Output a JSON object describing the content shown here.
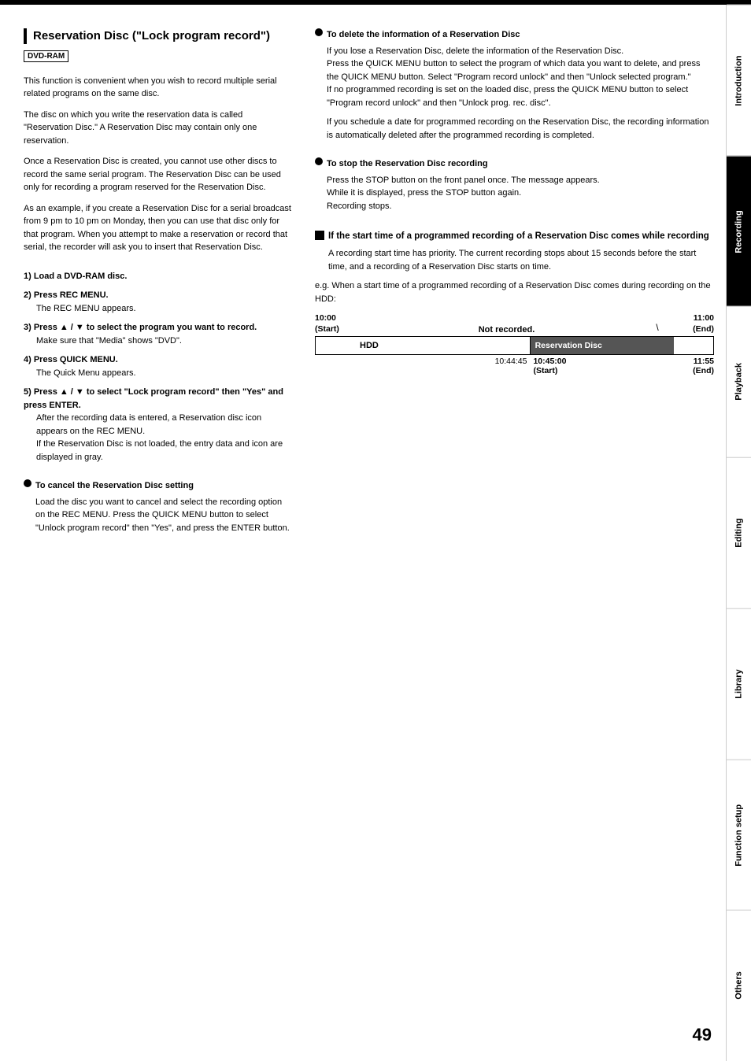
{
  "page": {
    "top_border": true,
    "page_number": "49"
  },
  "sidebar": {
    "tabs": [
      {
        "label": "Introduction",
        "active": false
      },
      {
        "label": "Recording",
        "active": true
      },
      {
        "label": "Playback",
        "active": false
      },
      {
        "label": "Editing",
        "active": false
      },
      {
        "label": "Library",
        "active": false
      },
      {
        "label": "Function setup",
        "active": false
      },
      {
        "label": "Others",
        "active": false
      }
    ]
  },
  "left_col": {
    "section_title": "Reservation Disc (\"Lock program record\")",
    "dvd_badge": "DVD-RAM",
    "paragraphs": [
      "This function is convenient when you wish to record multiple serial related programs on the same disc.",
      "The disc on which you write the reservation data is called \"Reservation Disc.\" A Reservation Disc may contain only one reservation.",
      "Once a Reservation Disc is created, you cannot use other discs to record the same serial program. The Reservation Disc can be used only for recording a program reserved for the Reservation Disc.",
      "As an example, if you create a Reservation Disc for a serial broadcast from 9 pm to 10 pm on Monday, then you can use that disc only for that program. When you attempt to make a reservation or record that serial, the recorder will ask you to insert that Reservation Disc."
    ],
    "steps": [
      {
        "label": "1) Load a DVD-RAM disc.",
        "sub": null
      },
      {
        "label": "2) Press REC MENU.",
        "sub": "The REC MENU appears."
      },
      {
        "label": "3) Press ▲ / ▼ to select the program you want to record.",
        "sub": "Make sure that \"Media\" shows \"DVD\"."
      },
      {
        "label": "4) Press QUICK MENU.",
        "sub": "The Quick Menu appears."
      },
      {
        "label": "5) Press ▲ / ▼ to select \"Lock program record\" then \"Yes\" and press ENTER.",
        "sub": "After the recording data is entered, a Reservation disc icon appears on the REC MENU.\nIf the Reservation Disc is not loaded, the entry data and icon are displayed in gray."
      }
    ],
    "cancel_bullet": {
      "title": "To cancel the Reservation Disc setting",
      "body": "Load the disc you want to cancel and select the recording option on the REC MENU. Press the QUICK MENU button to select \"Unlock program record\" then \"Yes\", and press the ENTER button."
    }
  },
  "right_col": {
    "delete_bullet": {
      "title": "To delete the information of a Reservation Disc",
      "body": "If you lose a Reservation Disc, delete the information of the Reservation Disc.\nPress the QUICK MENU button to select the program of which data you want to delete, and press the QUICK MENU button. Select \"Program record unlock\" and then \"Unlock selected program.\"\nIf no programmed recording is set on the loaded disc, press the QUICK MENU button to select \"Program record unlock\" and then \"Unlock prog. rec. disc\".",
      "body2": "If you schedule a date for programmed recording on the Reservation Disc, the recording information is automatically deleted after the programmed recording is completed."
    },
    "stop_bullet": {
      "title": "To stop the Reservation Disc recording",
      "body": "Press the STOP button on the front panel once. The message appears.\nWhile it is displayed, press the STOP button again.\nRecording stops."
    },
    "if_section": {
      "title": "If the start time of a programmed recording of a Reservation Disc comes while recording",
      "body": "A recording start time has priority.  The current recording stops about 15 seconds before the start time, and a recording of a Reservation Disc starts on time.",
      "eg": "e.g. When a start time of a programmed recording of a Reservation Disc comes during recording on the HDD:"
    },
    "timeline": {
      "start_time": "10:00\n(Start)",
      "end_time": "11:00\n(End)",
      "not_recorded": "Not recorded.",
      "hdd_label": "HDD",
      "res_label": "Reservation Disc",
      "mid_time": "10:44:45",
      "start2": "10:45:00\n(Start)",
      "end2": "11:55\n(End)"
    }
  }
}
